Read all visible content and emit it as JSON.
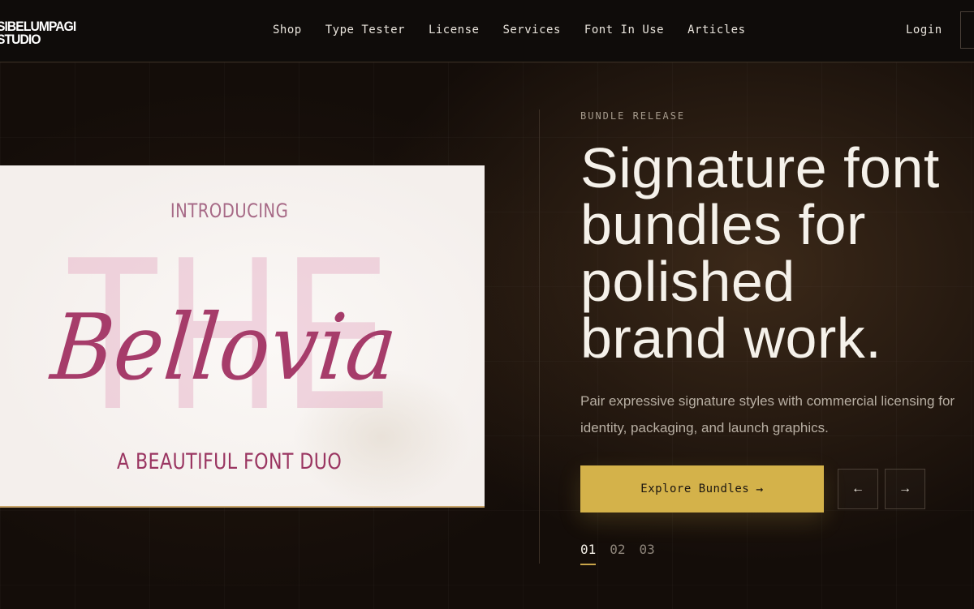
{
  "header": {
    "logo_line1": "SIBELUMPAGI",
    "logo_line2": "STUDIO",
    "nav": [
      "Shop",
      "Type Tester",
      "License",
      "Services",
      "Font In Use",
      "Articles"
    ],
    "login_label": "Login"
  },
  "card": {
    "intro": "INTRODUCING",
    "the": "THE",
    "script_title": "Bellovia",
    "tagline": "A BEAUTIFUL FONT DUO"
  },
  "hero": {
    "eyebrow": "BUNDLE RELEASE",
    "headline_lines": [
      "Signature font",
      "bundles for",
      "polished",
      "brand work."
    ],
    "description_lines": [
      "Pair expressive signature styles with commercial licensing for",
      "identity, packaging, and launch graphics."
    ],
    "cta_label": "Explore Bundles",
    "cta_arrow": "→",
    "prev_arrow": "←",
    "next_arrow": "→",
    "pager": [
      "01",
      "02",
      "03"
    ],
    "active_page": "01"
  },
  "colors": {
    "accent_gold": "#d4b24a",
    "background": "#140d09",
    "script_pink": "#a63c6a"
  },
  "icons": {
    "prev": "arrow-left-icon",
    "next": "arrow-right-icon",
    "cta": "arrow-right-icon"
  }
}
